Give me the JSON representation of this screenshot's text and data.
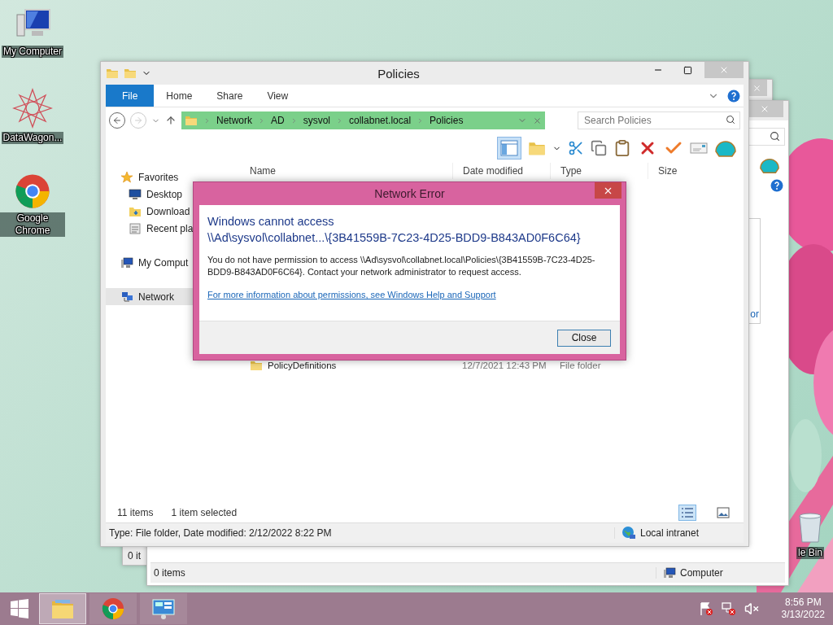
{
  "desktop_icons": [
    {
      "label": "My Computer"
    },
    {
      "label": "DataWagon..."
    },
    {
      "label": "Google Chrome"
    },
    {
      "label": "le Bin"
    }
  ],
  "background_windows": [
    {
      "status_text": "0 it"
    },
    {
      "fragment": "or",
      "status_items": "0 items",
      "status_location": "Computer"
    }
  ],
  "explorer": {
    "title": "Policies",
    "ribbon_tabs": [
      {
        "label": "File",
        "kind": "file"
      },
      {
        "label": "Home",
        "kind": "tab"
      },
      {
        "label": "Share",
        "kind": "tab"
      },
      {
        "label": "View",
        "kind": "tab"
      }
    ],
    "breadcrumb": [
      "Network",
      "AD",
      "sysvol",
      "collabnet.local",
      "Policies"
    ],
    "search": {
      "placeholder": "Search Policies"
    },
    "columns": [
      "Name",
      "Date modified",
      "Type",
      "Size"
    ],
    "navigation": [
      {
        "label": "Favorites",
        "kind": "group",
        "selected": false
      },
      {
        "label": "Desktop",
        "kind": "item",
        "selected": false
      },
      {
        "label": "Download",
        "kind": "item",
        "selected": false
      },
      {
        "label": "Recent pla",
        "kind": "item",
        "selected": false
      },
      {
        "label": "My Comput",
        "kind": "group",
        "selected": false
      },
      {
        "label": "Network",
        "kind": "group",
        "selected": true
      }
    ],
    "rows": [
      {
        "name": "PolicyDefinitions",
        "date": "12/7/2021 12:43 PM",
        "type": "File folder",
        "selected": false
      }
    ],
    "item_count": "11 items",
    "selection_count": "1 item selected",
    "status_text": "Type: File folder, Date modified: 2/12/2022 8:22 PM",
    "zone": "Local intranet"
  },
  "dialog": {
    "title": "Network Error",
    "heading": "Windows cannot access\n\\\\Ad\\sysvol\\collabnet...\\{3B41559B-7C23-4D25-BDD9-B843AD0F6C64}",
    "message": "You do not have permission to access \\\\Ad\\sysvol\\collabnet.local\\Policies\\{3B41559B-7C23-4D25-BDD9-B843AD0F6C64}. Contact your network administrator to request access.",
    "link": "For more information about permissions, see Windows Help and Support",
    "button": "Close"
  },
  "taskbar": {
    "apps": [
      {
        "kind": "explorer",
        "selected": true
      },
      {
        "kind": "chrome",
        "selected": false
      },
      {
        "kind": "manager",
        "selected": false
      }
    ],
    "time": "8:56 PM",
    "date": "3/13/2022"
  }
}
